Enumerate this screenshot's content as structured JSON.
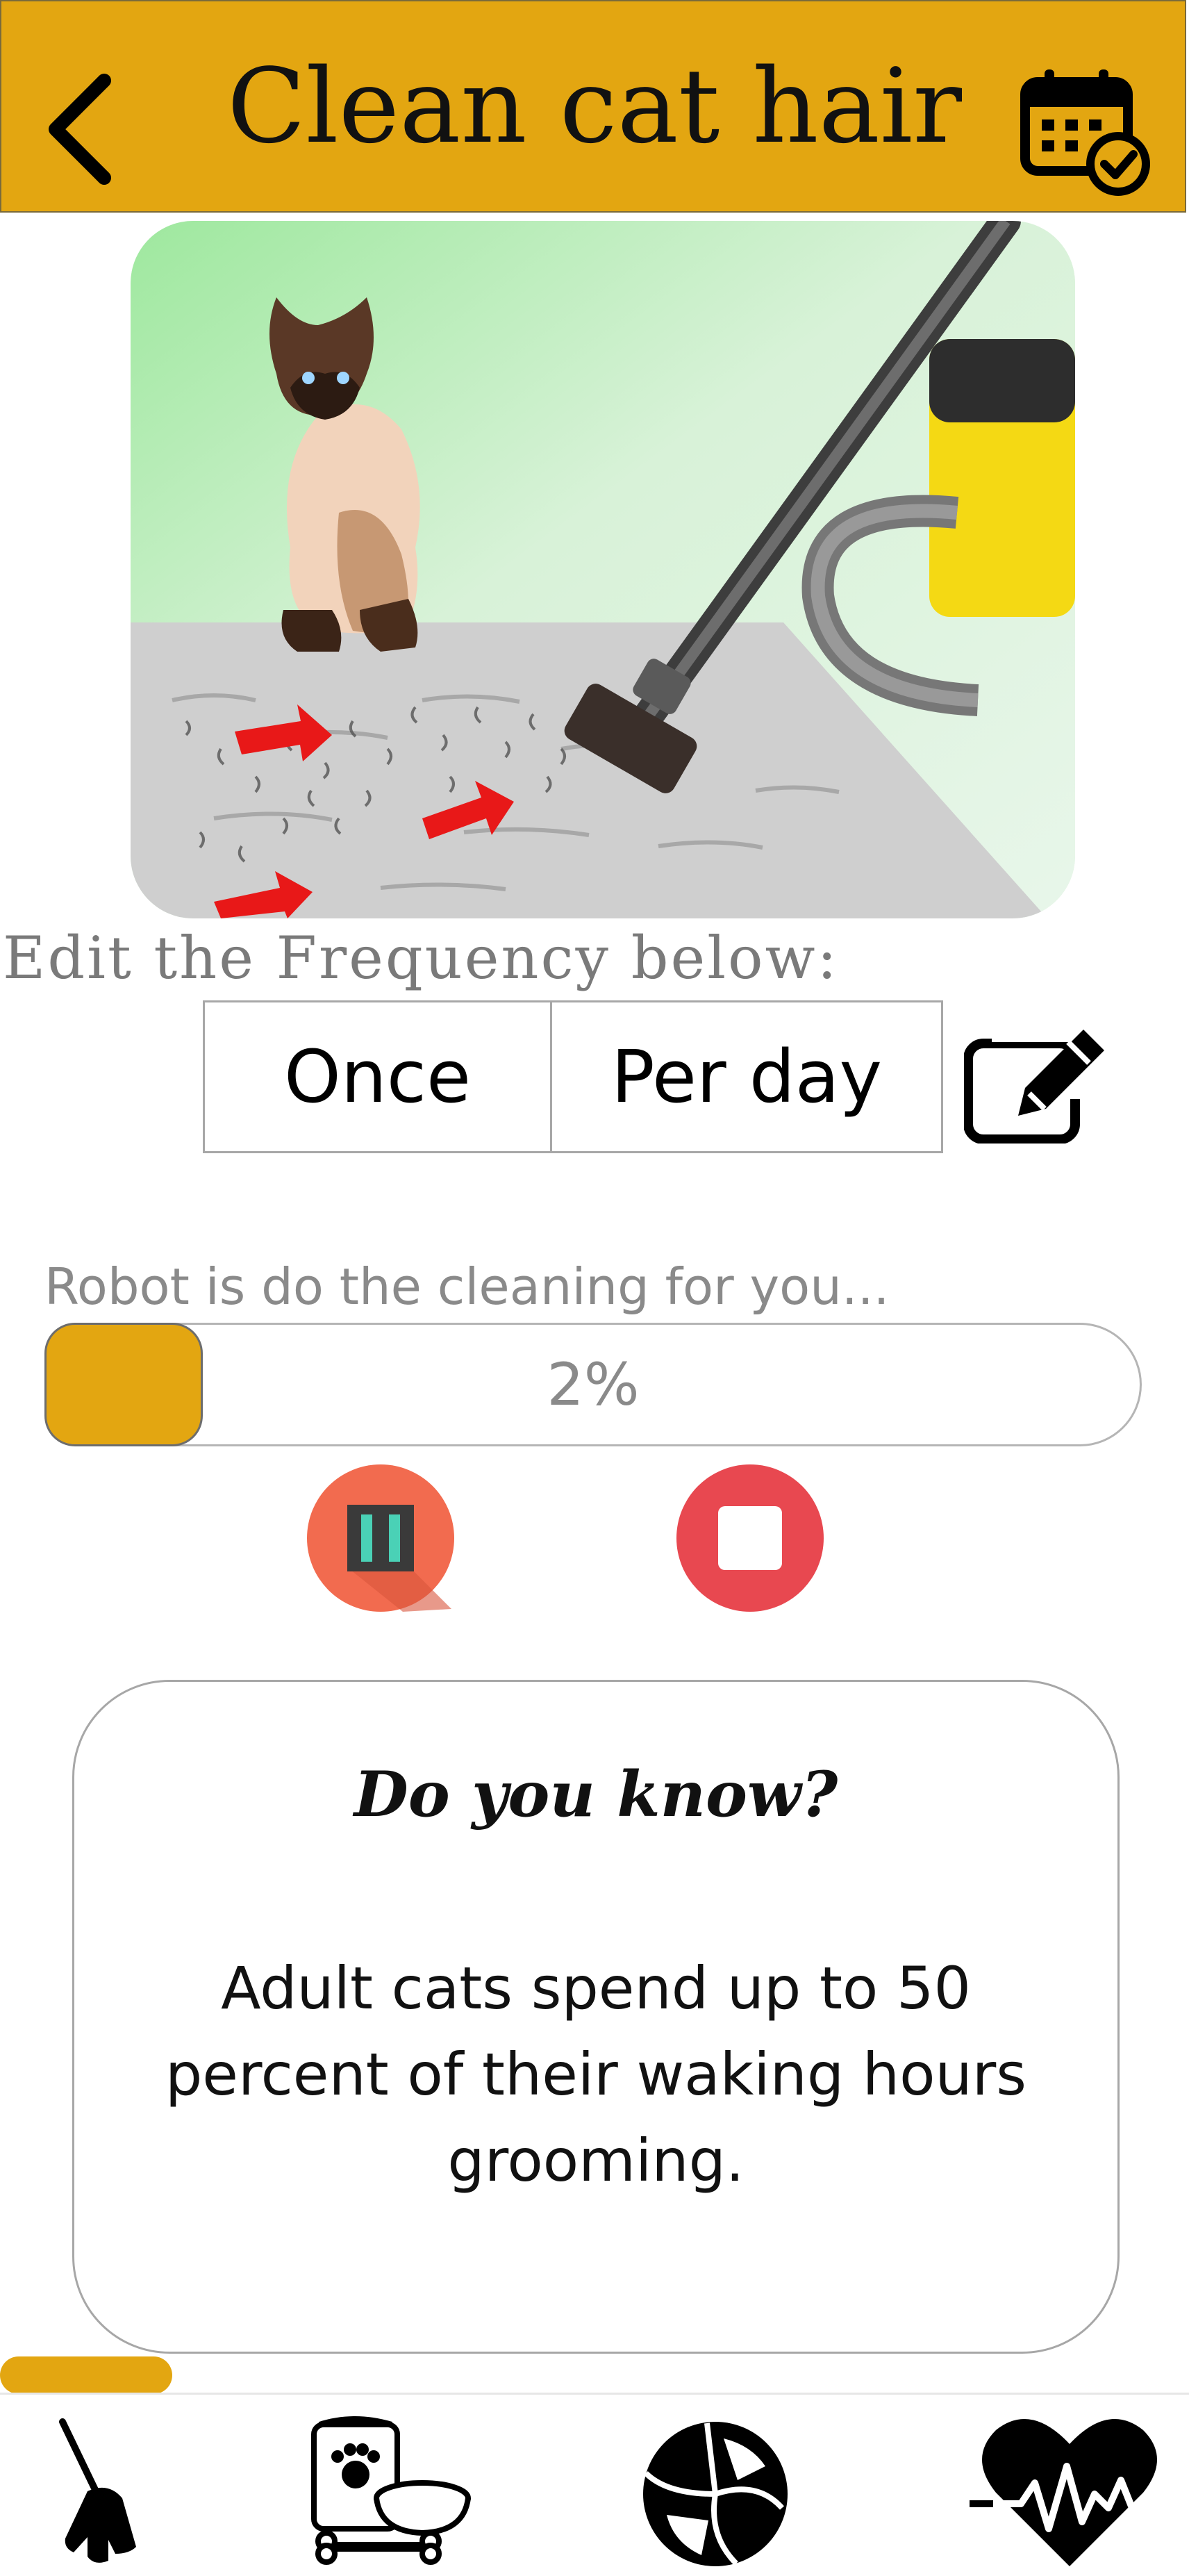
{
  "header": {
    "title": "Clean cat hair",
    "back_icon": "chevron-left-icon",
    "calendar_icon": "calendar-check-icon",
    "background_color": "#e3a611"
  },
  "hero": {
    "illustration": "cat-vacuum-illustration"
  },
  "frequency": {
    "prompt": "Edit the Frequency below:",
    "count": "Once",
    "period": "Per day",
    "edit_icon": "edit-pencil-icon"
  },
  "robot": {
    "status": "Robot is do the cleaning for you...",
    "progress_percent": 2,
    "progress_label": "2%",
    "pause_icon": "pause-icon",
    "stop_icon": "stop-icon",
    "pause_color": "#f26b4f",
    "stop_color": "#e84850"
  },
  "fact": {
    "title": "Do you know?",
    "text": "Adult cats spend up to 50 percent of their waking hours grooming."
  },
  "nav": {
    "items": [
      {
        "icon": "broom-icon"
      },
      {
        "icon": "pet-food-icon"
      },
      {
        "icon": "ball-icon"
      },
      {
        "icon": "heartbeat-icon"
      }
    ]
  }
}
